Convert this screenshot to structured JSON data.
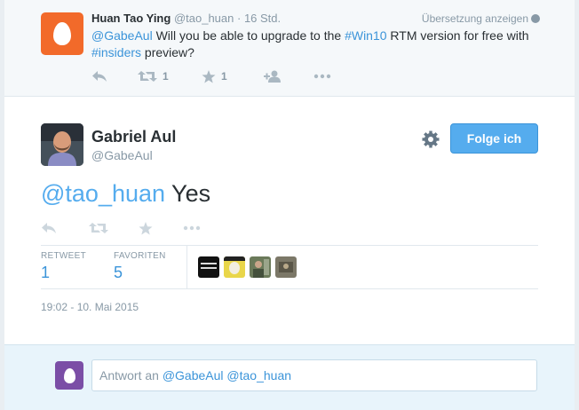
{
  "parent_tweet": {
    "name": "Huan Tao Ying",
    "handle": "@tao_huan",
    "separator": " · ",
    "time": "16 Std.",
    "translate": "Übersetzung anzeigen",
    "text_parts": {
      "mention": "@GabeAul",
      "t1": " Will you be able to upgrade to the ",
      "hashtag1": "#Win10",
      "t2": " RTM version for free with ",
      "hashtag2": "#insiders",
      "t3": " preview?"
    },
    "retweet_count": "1",
    "favorite_count": "1",
    "icons": [
      "reply-icon",
      "retweet-icon",
      "favorite-star-icon",
      "follow-user-icon",
      "more-dots-icon"
    ]
  },
  "main_tweet": {
    "name": "Gabriel Aul",
    "handle": "@GabeAul",
    "follow_label": "Folge ich",
    "text_mention": "@tao_huan",
    "text_rest": " Yes",
    "retweet_label": "RETWEET",
    "retweet_value": "1",
    "favorites_label": "FAVORITEN",
    "favorites_value": "5",
    "date": "19:02 - 10. Mai 2015"
  },
  "reply_box": {
    "prefix": "Antwort an ",
    "mention1": "@GabeAul",
    "space": " ",
    "mention2": "@tao_huan"
  },
  "colors": {
    "link": "#3b94d9",
    "follow_button": "#55acee",
    "egg_orange": "#f26a2a",
    "egg_purple": "#7b4ea6",
    "muted": "#8899a6"
  }
}
